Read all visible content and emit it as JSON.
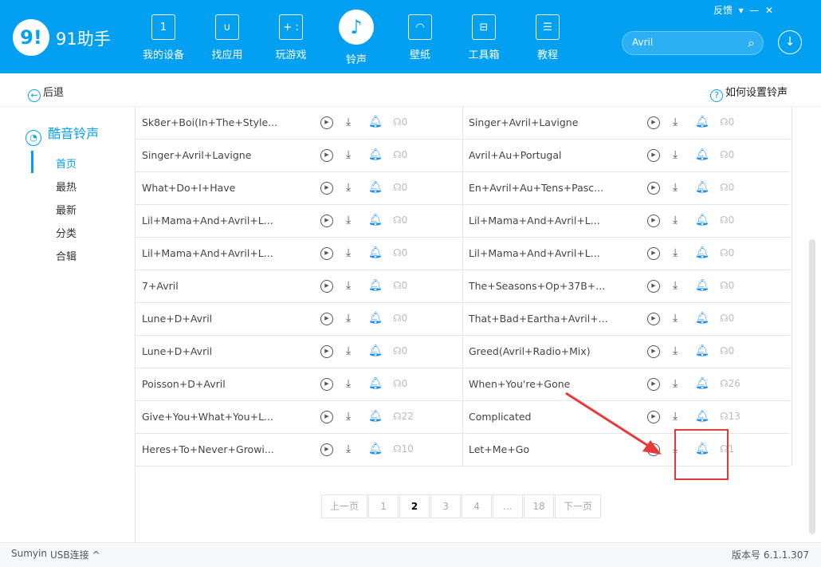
{
  "app": {
    "logo": "9!",
    "name": "91助手",
    "feedback": "反馈",
    "menu": "≡"
  },
  "nav": [
    {
      "label": "我的设备",
      "icon": "tablet-icon",
      "glyph": "1"
    },
    {
      "label": "找应用",
      "icon": "bag-icon",
      "glyph": "∪"
    },
    {
      "label": "玩游戏",
      "icon": "gamepad-icon",
      "glyph": "+ :"
    },
    {
      "label": "铃声",
      "icon": "music-note-icon",
      "glyph": "♪"
    },
    {
      "label": "壁纸",
      "icon": "wallpaper-icon",
      "glyph": "◠"
    },
    {
      "label": "工具箱",
      "icon": "toolbox-icon",
      "glyph": "⊟"
    },
    {
      "label": "教程",
      "icon": "clipboard-icon",
      "glyph": "☰"
    }
  ],
  "search": {
    "value": "Avril"
  },
  "subbar": {
    "back": "后退",
    "help": "如何设置铃声"
  },
  "sidebar": {
    "title": "酷音铃声",
    "items": [
      "首页",
      "最热",
      "最新",
      "分类",
      "合辑"
    ]
  },
  "songs_left": [
    {
      "name": "Sk8er+Boi(In+The+Style...",
      "count": "0"
    },
    {
      "name": "Singer+Avril+Lavigne",
      "count": "0"
    },
    {
      "name": "What+Do+I+Have",
      "count": "0"
    },
    {
      "name": "Lil+Mama+And+Avril+L...",
      "count": "0"
    },
    {
      "name": "Lil+Mama+And+Avril+L...",
      "count": "0"
    },
    {
      "name": "7+Avril",
      "count": "0"
    },
    {
      "name": "Lune+D+Avril",
      "count": "0"
    },
    {
      "name": "Lune+D+Avril",
      "count": "0"
    },
    {
      "name": "Poisson+D+Avril",
      "count": "0"
    },
    {
      "name": "Give+You+What+You+L...",
      "count": "22"
    },
    {
      "name": "Heres+To+Never+Growi...",
      "count": "10"
    }
  ],
  "songs_right": [
    {
      "name": "Singer+Avril+Lavigne",
      "count": "0"
    },
    {
      "name": "Avril+Au+Portugal",
      "count": "0"
    },
    {
      "name": "En+Avril+Au+Tens+Pasc...",
      "count": "0"
    },
    {
      "name": "Lil+Mama+And+Avril+L...",
      "count": "0"
    },
    {
      "name": "Lil+Mama+And+Avril+L...",
      "count": "0"
    },
    {
      "name": "The+Seasons+Op+37B+...",
      "count": "0"
    },
    {
      "name": "That+Bad+Eartha+Avril+...",
      "count": "0"
    },
    {
      "name": "Greed(Avril+Radio+Mix)",
      "count": "0"
    },
    {
      "name": "When+You're+Gone",
      "count": "26"
    },
    {
      "name": "Complicated",
      "count": "13"
    },
    {
      "name": "Let+Me+Go",
      "count": "1"
    }
  ],
  "pager": {
    "prev": "上一页",
    "pages": [
      "1",
      "2",
      "3",
      "4",
      "...",
      "18"
    ],
    "current": "2",
    "next": "下一页"
  },
  "status": {
    "device": "Sumyin",
    "conn": "USB连接 ^",
    "version": "版本号 6.1.1.307"
  },
  "colors": {
    "brand": "#03a0f2",
    "highlight": "#e8393a"
  }
}
